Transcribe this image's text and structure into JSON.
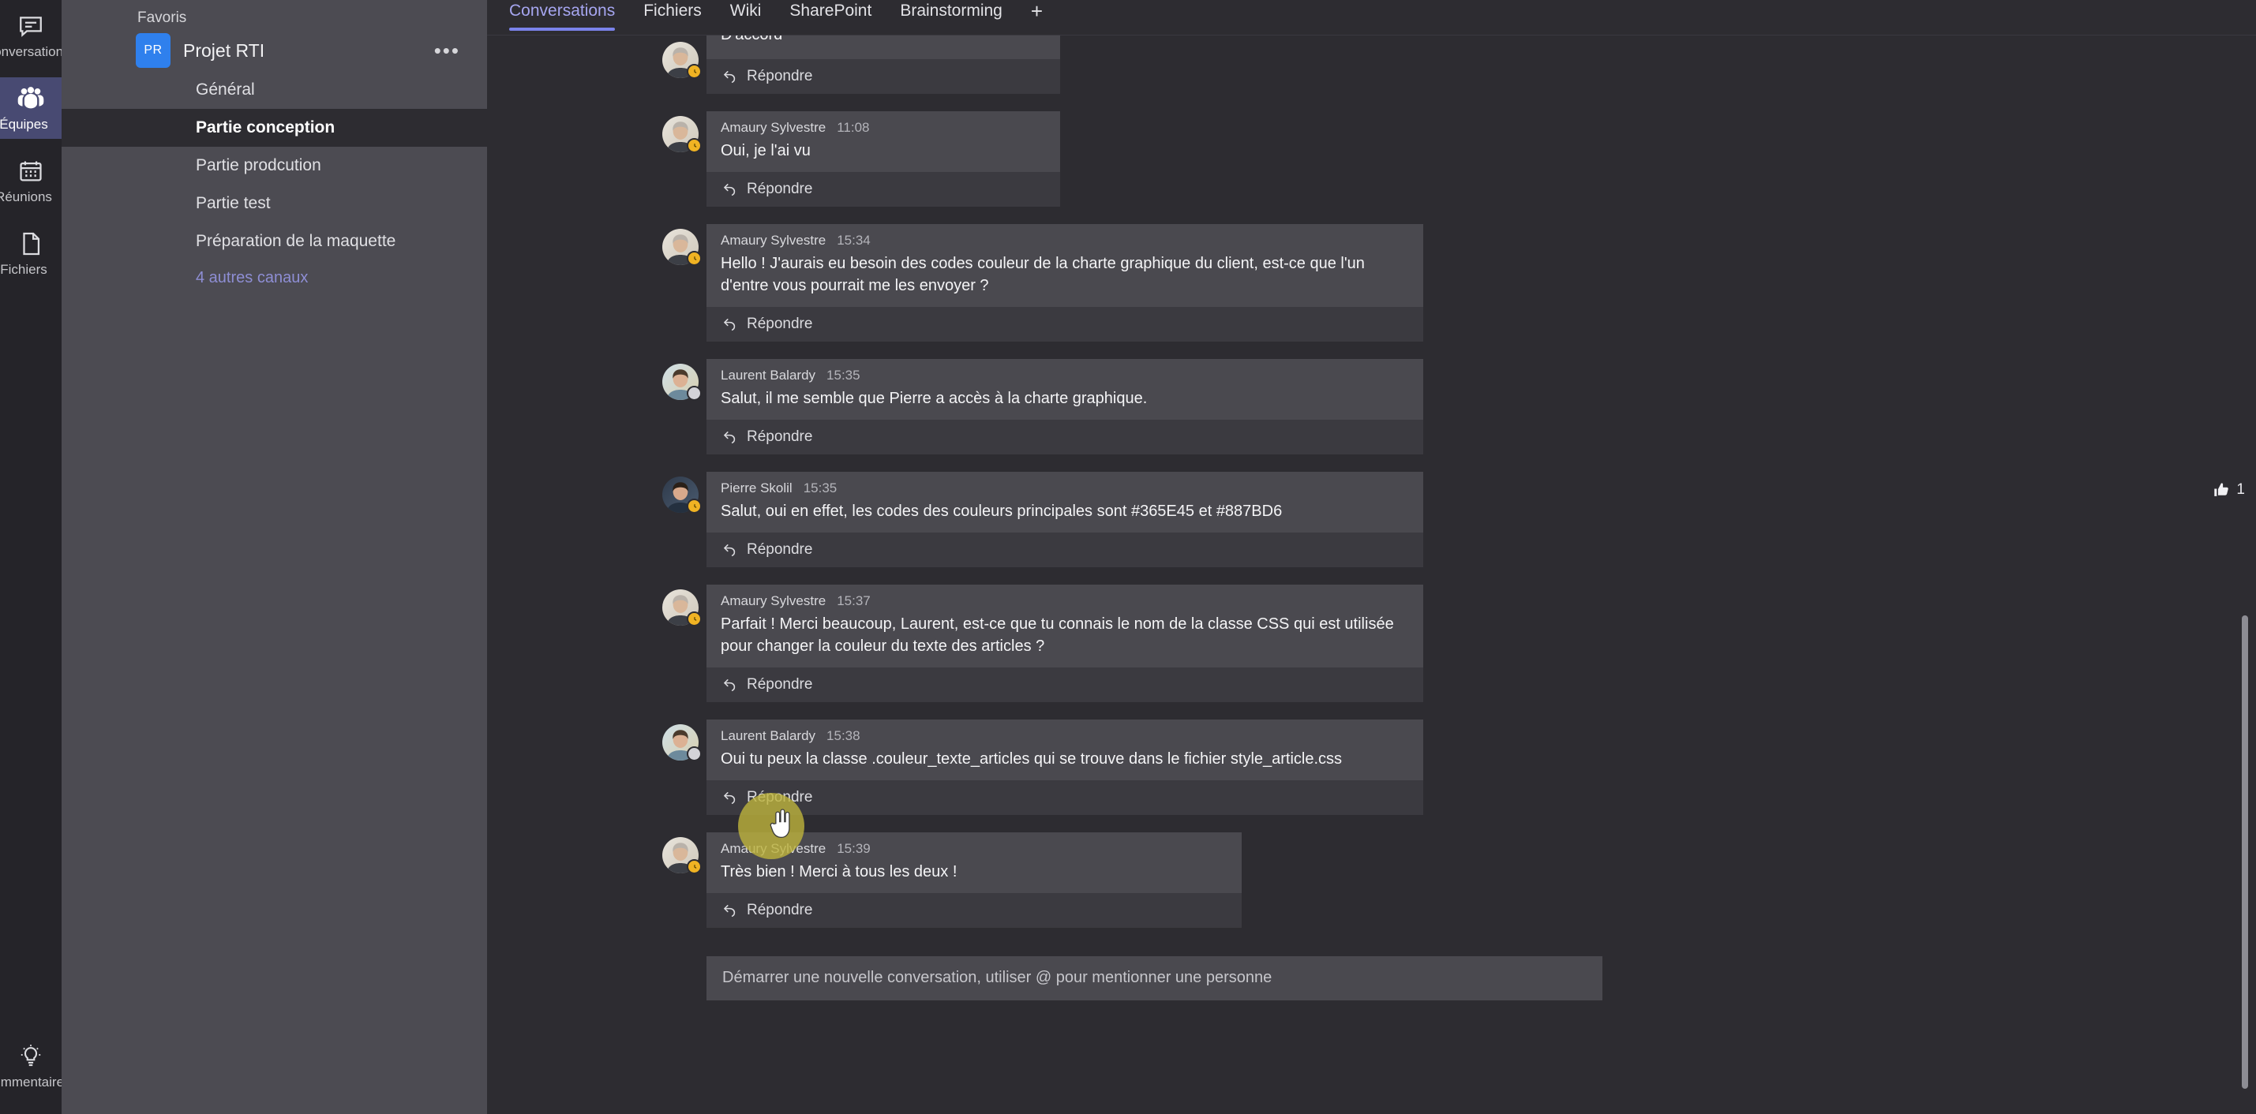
{
  "rail": {
    "items": [
      {
        "label": "Conversation",
        "icon": "chat-icon",
        "active": false
      },
      {
        "label": "Équipes",
        "icon": "teams-icon",
        "active": true
      },
      {
        "label": "Réunions",
        "icon": "calendar-icon",
        "active": false
      },
      {
        "label": "Fichiers",
        "icon": "file-icon",
        "active": false
      }
    ],
    "bottom": {
      "label": "Commentaire",
      "icon": "lightbulb-icon"
    }
  },
  "sidebar": {
    "header": "Favoris",
    "team": {
      "name": "Projet RTI",
      "initials": "PR",
      "avatar_color": "#2f80ed",
      "more_label": "•••"
    },
    "channels": [
      {
        "name": "Général",
        "selected": false
      },
      {
        "name": "Partie conception",
        "selected": true
      },
      {
        "name": "Partie prodcution",
        "selected": false
      },
      {
        "name": "Partie test",
        "selected": false
      },
      {
        "name": "Préparation de la maquette",
        "selected": false
      }
    ],
    "more_channels": "4 autres canaux",
    "link_color": "#8e8ed4"
  },
  "tabs": {
    "items": [
      {
        "label": "Conversations",
        "active": true
      },
      {
        "label": "Fichiers",
        "active": false
      },
      {
        "label": "Wiki",
        "active": false
      },
      {
        "label": "SharePoint",
        "active": false
      },
      {
        "label": "Brainstorming",
        "active": false
      }
    ],
    "add_label": "+",
    "active_underline_color": "#7b83eb"
  },
  "reply_label": "Répondre",
  "messages": [
    {
      "author": "",
      "time": "",
      "text": "D'accord",
      "presence": "away",
      "avatar": "amaury",
      "clipped_top": true,
      "reaction": null
    },
    {
      "author": "Amaury Sylvestre",
      "time": "11:08",
      "text": "Oui, je l'ai vu",
      "presence": "away",
      "avatar": "amaury",
      "clipped_top": false,
      "reaction": null
    },
    {
      "author": "Amaury Sylvestre",
      "time": "15:34",
      "text": "Hello ! J'aurais eu besoin des codes couleur de la charte graphique du client, est-ce que l'un d'entre vous pourrait me les envoyer ?",
      "presence": "away",
      "avatar": "amaury",
      "clipped_top": false,
      "reaction": null
    },
    {
      "author": "Laurent Balardy",
      "time": "15:35",
      "text": "Salut, il me semble que Pierre a accès à la charte graphique.",
      "presence": "offline",
      "avatar": "laurent",
      "clipped_top": false,
      "reaction": null
    },
    {
      "author": "Pierre Skolil",
      "time": "15:35",
      "text": "Salut, oui en effet, les codes des couleurs principales sont #365E45 et #887BD6",
      "presence": "away",
      "avatar": "pierre",
      "clipped_top": false,
      "reaction": {
        "icon": "thumbs-up-icon",
        "count": "1"
      }
    },
    {
      "author": "Amaury Sylvestre",
      "time": "15:37",
      "text": "Parfait ! Merci beaucoup, Laurent, est-ce que tu connais le nom de la classe CSS qui est utilisée pour changer la couleur du texte des articles ?",
      "presence": "away",
      "avatar": "amaury",
      "clipped_top": false,
      "reaction": null
    },
    {
      "author": "Laurent Balardy",
      "time": "15:38",
      "text": "Oui tu peux la classe .couleur_texte_articles qui se trouve dans le fichier style_article.css",
      "presence": "offline",
      "avatar": "laurent",
      "clipped_top": false,
      "reaction": null
    },
    {
      "author": "Amaury Sylvestre",
      "time": "15:39",
      "text": "Très bien ! Merci à tous les deux !",
      "presence": "away",
      "avatar": "amaury",
      "clipped_top": false,
      "reaction": null
    }
  ],
  "compose": {
    "placeholder": "Démarrer une nouvelle conversation, utiliser @ pour mentionner une personne"
  },
  "cursor": {
    "highlight_color": "#bdb43c",
    "icon": "pointing-hand-cursor"
  }
}
